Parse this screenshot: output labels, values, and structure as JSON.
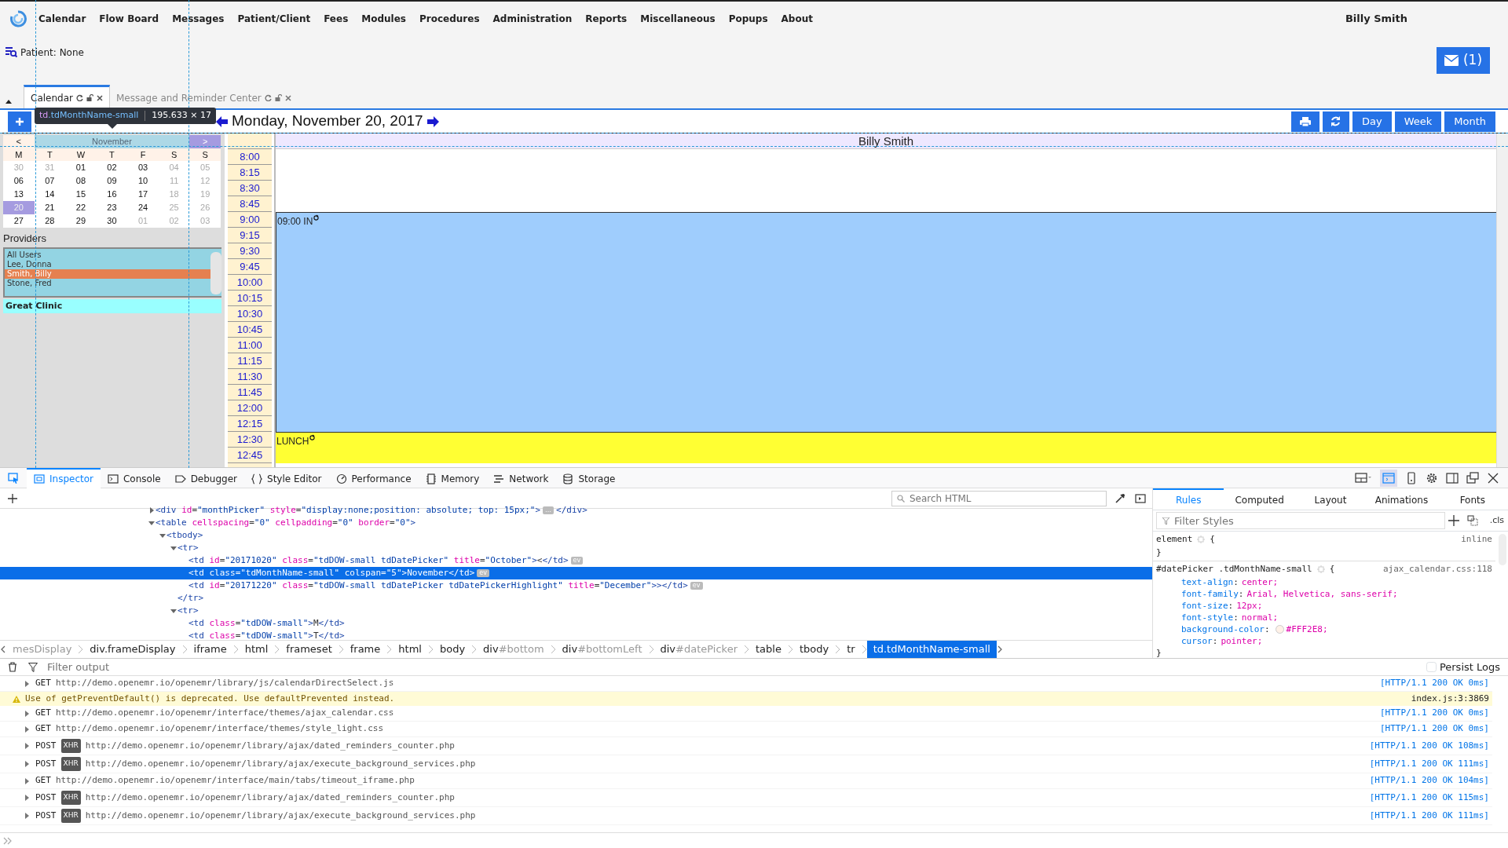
{
  "nav": {
    "menu": [
      {
        "label": "Calendar"
      },
      {
        "label": "Flow Board"
      },
      {
        "label": "Messages"
      },
      {
        "label": "Patient/Client"
      },
      {
        "label": "Fees"
      },
      {
        "label": "Modules"
      },
      {
        "label": "Procedures"
      },
      {
        "label": "Administration"
      },
      {
        "label": "Reports"
      },
      {
        "label": "Miscellaneous"
      },
      {
        "label": "Popups"
      },
      {
        "label": "About"
      }
    ],
    "user": "Billy Smith"
  },
  "patient": {
    "label": "Patient: None"
  },
  "messages_button": {
    "count": "(1)"
  },
  "tabs": [
    {
      "label": "Calendar",
      "selected": true
    },
    {
      "label": "Message and Reminder Center",
      "selected": false
    }
  ],
  "calendar": {
    "title": "Monday, November 20, 2017",
    "view_buttons": [
      {
        "label": "Day"
      },
      {
        "label": "Week"
      },
      {
        "label": "Month"
      }
    ],
    "mini": {
      "prev": "<",
      "month": "November",
      "next": ">",
      "weekdays": [
        "M",
        "T",
        "W",
        "T",
        "F",
        "S",
        "S"
      ],
      "weeks": [
        [
          {
            "day": "30",
            "muted": true,
            "selected": false
          },
          {
            "day": "31",
            "muted": true,
            "selected": false
          },
          {
            "day": "01",
            "muted": false,
            "selected": false
          },
          {
            "day": "02",
            "muted": false,
            "selected": false
          },
          {
            "day": "03",
            "muted": false,
            "selected": false
          },
          {
            "day": "04",
            "muted": true,
            "selected": false
          },
          {
            "day": "05",
            "muted": true,
            "selected": false
          }
        ],
        [
          {
            "day": "06",
            "muted": false,
            "selected": false
          },
          {
            "day": "07",
            "muted": false,
            "selected": false
          },
          {
            "day": "08",
            "muted": false,
            "selected": false
          },
          {
            "day": "09",
            "muted": false,
            "selected": false
          },
          {
            "day": "10",
            "muted": false,
            "selected": false
          },
          {
            "day": "11",
            "muted": true,
            "selected": false
          },
          {
            "day": "12",
            "muted": true,
            "selected": false
          }
        ],
        [
          {
            "day": "13",
            "muted": false,
            "selected": false
          },
          {
            "day": "14",
            "muted": false,
            "selected": false
          },
          {
            "day": "15",
            "muted": false,
            "selected": false
          },
          {
            "day": "16",
            "muted": false,
            "selected": false
          },
          {
            "day": "17",
            "muted": false,
            "selected": false
          },
          {
            "day": "18",
            "muted": true,
            "selected": false
          },
          {
            "day": "19",
            "muted": true,
            "selected": false
          }
        ],
        [
          {
            "day": "20",
            "muted": true,
            "selected": true
          },
          {
            "day": "21",
            "muted": false,
            "selected": false
          },
          {
            "day": "22",
            "muted": false,
            "selected": false
          },
          {
            "day": "23",
            "muted": false,
            "selected": false
          },
          {
            "day": "24",
            "muted": false,
            "selected": false
          },
          {
            "day": "25",
            "muted": true,
            "selected": false
          },
          {
            "day": "26",
            "muted": true,
            "selected": false
          }
        ],
        [
          {
            "day": "27",
            "muted": false,
            "selected": false
          },
          {
            "day": "28",
            "muted": false,
            "selected": false
          },
          {
            "day": "29",
            "muted": false,
            "selected": false
          },
          {
            "day": "30",
            "muted": false,
            "selected": false
          },
          {
            "day": "01",
            "muted": true,
            "selected": false
          },
          {
            "day": "02",
            "muted": true,
            "selected": false
          },
          {
            "day": "03",
            "muted": true,
            "selected": false
          }
        ]
      ]
    },
    "providers_label": "Providers",
    "providers": [
      {
        "name": "All Users",
        "selected": false
      },
      {
        "name": "Lee, Donna",
        "selected": false
      },
      {
        "name": "Smith, Billy",
        "selected": true
      },
      {
        "name": "Stone, Fred",
        "selected": false
      }
    ],
    "facility": "Great Clinic",
    "provider_header": "Billy Smith",
    "times": [
      {
        "label": "8:00"
      },
      {
        "label": "8:15"
      },
      {
        "label": "8:30"
      },
      {
        "label": "8:45"
      },
      {
        "label": "9:00",
        "event": {
          "kind": "appointment",
          "label": "09:00 IN"
        }
      },
      {
        "label": "9:15"
      },
      {
        "label": "9:30"
      },
      {
        "label": "9:45"
      },
      {
        "label": "10:00"
      },
      {
        "label": "10:15"
      },
      {
        "label": "10:30"
      },
      {
        "label": "10:45"
      },
      {
        "label": "11:00"
      },
      {
        "label": "11:15"
      },
      {
        "label": "11:30"
      },
      {
        "label": "11:45"
      },
      {
        "label": "12:00"
      },
      {
        "label": "12:15"
      },
      {
        "label": "12:30",
        "event": {
          "kind": "lunch",
          "label": "LUNCH"
        }
      },
      {
        "label": "12:45"
      }
    ]
  },
  "inspector_tooltip": {
    "tag": "td",
    "classes": ".tdMonthName-small",
    "size": "195.633 × 17"
  },
  "devtools": {
    "tools": [
      {
        "label": "Inspector",
        "selected": true
      },
      {
        "label": "Console",
        "selected": false
      },
      {
        "label": "Debugger",
        "selected": false
      },
      {
        "label": "Style Editor",
        "selected": false
      },
      {
        "label": "Performance",
        "selected": false
      },
      {
        "label": "Memory",
        "selected": false
      },
      {
        "label": "Network",
        "selected": false
      },
      {
        "label": "Storage",
        "selected": false
      }
    ],
    "search": {
      "placeholder": "Search HTML"
    },
    "tree": [
      {
        "markup": "<div id=\"monthPicker\" style=\"display:none;position: absolute; top: 15px;\">",
        "expanded": false,
        "badge": "…",
        "closing": "</div>",
        "selected": false
      },
      {
        "markup": "<table cellspacing=\"0\" cellpadding=\"0\" border=\"0\">",
        "expanded": true,
        "selected": false,
        "children": [
          {
            "markup": "<tbody>",
            "expanded": true,
            "selected": false,
            "children": [
              {
                "markup": "<tr>",
                "expanded": true,
                "selected": false,
                "closing": "</tr>",
                "children": [
                  {
                    "markup": "<td id=\"20171020\" class=\"tdDOW-small tdDatePicker\" title=\"October\"><</td>",
                    "badge": "ev",
                    "selected": false
                  },
                  {
                    "markup": "<td class=\"tdMonthName-small\" colspan=\"5\">November</td>",
                    "badge": "ev",
                    "selected": true
                  },
                  {
                    "markup": "<td id=\"20171220\" class=\"tdDOW-small tdDatePicker tdDatePickerHighlight\" title=\"December\">></td>",
                    "badge": "ev",
                    "selected": false
                  }
                ]
              },
              {
                "markup": "<tr>",
                "expanded": true,
                "selected": false,
                "children": [
                  {
                    "markup": "<td class=\"tdDOW-small\">M</td>",
                    "selected": false
                  },
                  {
                    "markup": "<td class=\"tdDOW-small\">T</td>",
                    "selected": false
                  }
                ]
              }
            ]
          }
        ]
      }
    ],
    "breadcrumbs": [
      {
        "id": "mesDisplay",
        "selected": false
      },
      {
        "tag": "div.frameDisplay",
        "selected": false
      },
      {
        "tag": "iframe",
        "selected": false
      },
      {
        "tag": "html",
        "selected": false
      },
      {
        "tag": "frameset",
        "selected": false
      },
      {
        "tag": "frame",
        "selected": false
      },
      {
        "tag": "html",
        "selected": false
      },
      {
        "tag": "body",
        "selected": false
      },
      {
        "tag": "div",
        "id": "#bottom",
        "selected": false
      },
      {
        "tag": "div",
        "id": "#bottomLeft",
        "selected": false
      },
      {
        "tag": "div",
        "id": "#datePicker",
        "selected": false
      },
      {
        "tag": "table",
        "selected": false
      },
      {
        "tag": "tbody",
        "selected": false
      },
      {
        "tag": "tr",
        "selected": false
      },
      {
        "tag": "td.tdMonthName-small",
        "selected": true
      }
    ],
    "sidebar": {
      "tabs": [
        {
          "label": "Rules",
          "selected": true
        },
        {
          "label": "Computed",
          "selected": false
        },
        {
          "label": "Layout",
          "selected": false
        },
        {
          "label": "Animations",
          "selected": false
        },
        {
          "label": "Fonts",
          "selected": false
        }
      ],
      "filter": {
        "placeholder": "Filter Styles"
      },
      "class_toggle": ".cls",
      "rules": [
        {
          "selector": "element",
          "open": "{",
          "close": "}",
          "source": "inline"
        },
        {
          "selector": "#datePicker .tdMonthName-small",
          "open": "{",
          "close": "}",
          "source": "ajax_calendar.css:118",
          "declarations": [
            {
              "property": "text-align",
              "colon": ":",
              "value": "center;"
            },
            {
              "property": "font-family",
              "colon": ":",
              "value": "Arial, Helvetica, sans-serif;"
            },
            {
              "property": "font-size",
              "colon": ":",
              "value": "12px;"
            },
            {
              "property": "font-style",
              "colon": ":",
              "value": "normal;"
            },
            {
              "property": "background-color",
              "colon": ":",
              "value": "#FFF2E8;",
              "color": "#fff2e8"
            },
            {
              "property": "cursor",
              "colon": ":",
              "value": "pointer;"
            }
          ]
        }
      ]
    }
  },
  "console": {
    "filter": {
      "placeholder": "Filter output"
    },
    "persist_logs": {
      "label": "Persist Logs",
      "checked": false
    },
    "messages": [
      {
        "kind": "network",
        "method": "GET",
        "url": "http://demo.openemr.io/openemr/library/js/calendarDirectSelect.js",
        "status": "[HTTP/1.1 200 OK 0ms]"
      },
      {
        "kind": "warning",
        "text": "Use of getPreventDefault() is deprecated.  Use defaultPrevented instead.",
        "source": "index.js:3:3869"
      },
      {
        "kind": "network",
        "method": "GET",
        "url": "http://demo.openemr.io/openemr/interface/themes/ajax_calendar.css",
        "status": "[HTTP/1.1 200 OK 0ms]"
      },
      {
        "kind": "network",
        "method": "GET",
        "url": "http://demo.openemr.io/openemr/interface/themes/style_light.css",
        "status": "[HTTP/1.1 200 OK 0ms]"
      },
      {
        "kind": "network",
        "method": "POST",
        "badge": "XHR",
        "url": "http://demo.openemr.io/openemr/library/ajax/dated_reminders_counter.php",
        "status": "[HTTP/1.1 200 OK 108ms]"
      },
      {
        "kind": "network",
        "method": "POST",
        "badge": "XHR",
        "url": "http://demo.openemr.io/openemr/library/ajax/execute_background_services.php",
        "status": "[HTTP/1.1 200 OK 111ms]"
      },
      {
        "kind": "network",
        "method": "GET",
        "url": "http://demo.openemr.io/openemr/interface/main/tabs/timeout_iframe.php",
        "status": "[HTTP/1.1 200 OK 104ms]"
      },
      {
        "kind": "network",
        "method": "POST",
        "badge": "XHR",
        "url": "http://demo.openemr.io/openemr/library/ajax/dated_reminders_counter.php",
        "status": "[HTTP/1.1 200 OK 115ms]"
      },
      {
        "kind": "network",
        "method": "POST",
        "badge": "XHR",
        "url": "http://demo.openemr.io/openemr/library/ajax/execute_background_services.php",
        "status": "[HTTP/1.1 200 OK 111ms]"
      }
    ]
  }
}
